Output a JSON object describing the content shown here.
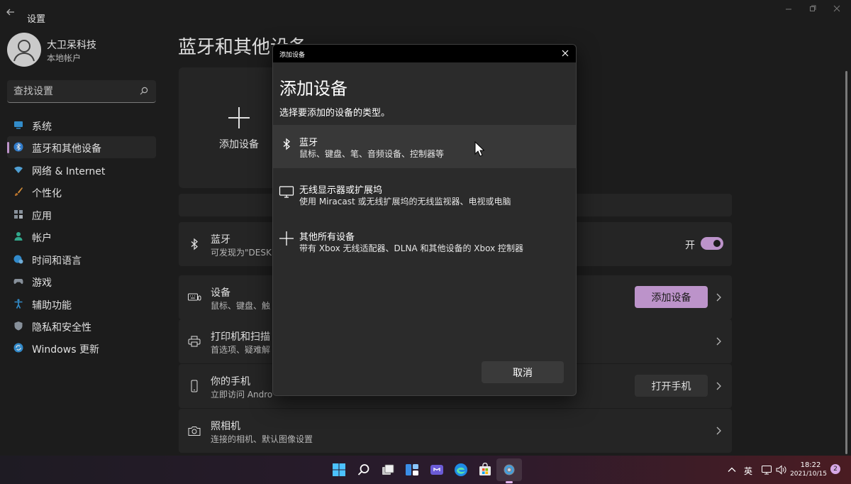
{
  "app": {
    "title": "设置",
    "back_icon": "back-arrow-icon"
  },
  "profile": {
    "name": "大卫呆科技",
    "account_type": "本地帐户"
  },
  "search": {
    "placeholder": "查找设置"
  },
  "sidebar": {
    "items": [
      {
        "label": "系统",
        "icon": "monitor-icon",
        "color": "#3aa0e6"
      },
      {
        "label": "蓝牙和其他设备",
        "icon": "bluetooth-icon",
        "color": "#3a8ee6",
        "active": true
      },
      {
        "label": "网络 & Internet",
        "icon": "wifi-icon",
        "color": "#5ab4f0"
      },
      {
        "label": "个性化",
        "icon": "brush-icon",
        "color": "#f0a040"
      },
      {
        "label": "应用",
        "icon": "apps-icon",
        "color": "#9aa4b0"
      },
      {
        "label": "帐户",
        "icon": "person-icon",
        "color": "#3ac0a0"
      },
      {
        "label": "时间和语言",
        "icon": "globe-clock-icon",
        "color": "#3a9ee6"
      },
      {
        "label": "游戏",
        "icon": "gamepad-icon",
        "color": "#9aa4b0"
      },
      {
        "label": "辅助功能",
        "icon": "accessibility-icon",
        "color": "#3aa0e6"
      },
      {
        "label": "隐私和安全性",
        "icon": "shield-icon",
        "color": "#9aa4b0"
      },
      {
        "label": "Windows 更新",
        "icon": "update-icon",
        "color": "#3a9ee6"
      }
    ]
  },
  "main": {
    "title": "蓝牙和其他设备",
    "add_tile_label": "添加设备",
    "bluetooth_card": {
      "title": "蓝牙",
      "subtitle": "可发现为\"DESK",
      "toggle_label": "开",
      "toggle_on": true
    },
    "devices_card": {
      "title": "设备",
      "subtitle": "鼠标、键盘、触",
      "button": "添加设备"
    },
    "printers_card": {
      "title": "打印机和扫描",
      "subtitle": "首选项、疑难解"
    },
    "phone_card": {
      "title": "你的手机",
      "subtitle": "立即访问 Andro",
      "button": "打开手机"
    },
    "camera_card": {
      "title": "照相机",
      "subtitle": "连接的相机、默认图像设置"
    }
  },
  "dialog": {
    "caption": "添加设备",
    "heading": "添加设备",
    "description": "选择要添加的设备的类型。",
    "options": [
      {
        "title": "蓝牙",
        "subtitle": "鼠标、键盘、笔、音频设备、控制器等",
        "icon": "bluetooth-icon"
      },
      {
        "title": "无线显示器或扩展坞",
        "subtitle": "使用 Miracast 或无线扩展坞的无线监视器、电视或电脑",
        "icon": "monitor-icon"
      },
      {
        "title": "其他所有设备",
        "subtitle": "带有 Xbox 无线适配器、DLNA 和其他设备的 Xbox 控制器",
        "icon": "plus-icon"
      }
    ],
    "cancel": "取消"
  },
  "taskbar": {
    "apps": [
      "windows-start-icon",
      "search-icon",
      "task-view-icon",
      "widgets-icon",
      "teams-chat-icon",
      "edge-icon",
      "store-icon",
      "settings-icon"
    ],
    "ime": "英",
    "time": "18:22",
    "date": "2021/10/15",
    "notifications": "2"
  },
  "colors": {
    "accent": "#d7a8e6",
    "background": "#202020",
    "card": "#2b2b2b"
  }
}
